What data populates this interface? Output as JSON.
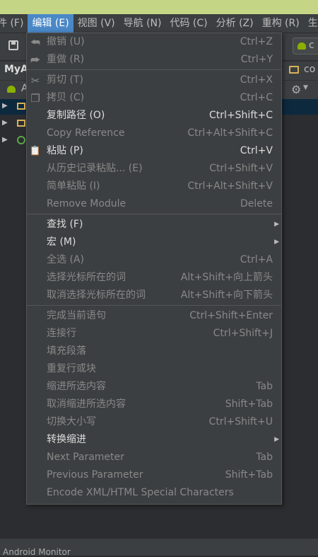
{
  "menubar": [
    {
      "label": "件 (F)"
    },
    {
      "label": "编辑 (E)"
    },
    {
      "label": "视图 (V)"
    },
    {
      "label": "导航 (N)"
    },
    {
      "label": "代码 (C)"
    },
    {
      "label": "分析 (Z)"
    },
    {
      "label": "重构 (R)"
    },
    {
      "label": "生"
    }
  ],
  "toolbar": {
    "right_text": "c"
  },
  "navbar": {
    "project": "MyA",
    "crumb": "co"
  },
  "projbar": {
    "label": "A"
  },
  "statusbar": {
    "label": "Android Monitor"
  },
  "edit_menu": {
    "groups": [
      [
        {
          "label": "撤销 (U)",
          "shortcut": "Ctrl+Z",
          "enabled": false,
          "icon": "undo-icon"
        },
        {
          "label": "重做 (R)",
          "shortcut": "Ctrl+Y",
          "enabled": false,
          "icon": "redo-icon"
        }
      ],
      [
        {
          "label": "剪切 (T)",
          "shortcut": "Ctrl+X",
          "enabled": false,
          "icon": "cut-icon"
        },
        {
          "label": "拷贝 (C)",
          "shortcut": "Ctrl+C",
          "enabled": false,
          "icon": "copy-icon"
        },
        {
          "label": "复制路径 (O)",
          "shortcut": "Ctrl+Shift+C",
          "enabled": true
        },
        {
          "label": "Copy Reference",
          "shortcut": "Ctrl+Alt+Shift+C",
          "enabled": false
        },
        {
          "label": "粘贴 (P)",
          "shortcut": "Ctrl+V",
          "enabled": true,
          "icon": "paste-icon"
        },
        {
          "label": "从历史记录粘贴... (E)",
          "shortcut": "Ctrl+Shift+V",
          "enabled": false
        },
        {
          "label": "简单粘贴 (I)",
          "shortcut": "Ctrl+Alt+Shift+V",
          "enabled": false
        },
        {
          "label": "Remove Module",
          "shortcut": "Delete",
          "enabled": false
        }
      ],
      [
        {
          "label": "查找 (F)",
          "shortcut": "",
          "enabled": true,
          "submenu": true
        },
        {
          "label": "宏 (M)",
          "shortcut": "",
          "enabled": true,
          "submenu": true
        },
        {
          "label": "全选 (A)",
          "shortcut": "Ctrl+A",
          "enabled": false
        },
        {
          "label": "选择光标所在的词",
          "shortcut": "Alt+Shift+向上箭头",
          "enabled": false
        },
        {
          "label": "取消选择光标所在的词",
          "shortcut": "Alt+Shift+向下箭头",
          "enabled": false
        }
      ],
      [
        {
          "label": "完成当前语句",
          "shortcut": "Ctrl+Shift+Enter",
          "enabled": false
        },
        {
          "label": "连接行",
          "shortcut": "Ctrl+Shift+J",
          "enabled": false
        },
        {
          "label": "填充段落",
          "shortcut": "",
          "enabled": false
        },
        {
          "label": "重复行或块",
          "shortcut": "",
          "enabled": false
        },
        {
          "label": "缩进所选内容",
          "shortcut": "Tab",
          "enabled": false
        },
        {
          "label": "取消缩进所选内容",
          "shortcut": "Shift+Tab",
          "enabled": false
        },
        {
          "label": "切换大小写",
          "shortcut": "Ctrl+Shift+U",
          "enabled": false
        },
        {
          "label": "转换缩进",
          "shortcut": "",
          "enabled": true,
          "submenu": true
        },
        {
          "label": "Next Parameter",
          "shortcut": "Tab",
          "enabled": false
        },
        {
          "label": "Previous Parameter",
          "shortcut": "Shift+Tab",
          "enabled": false
        },
        {
          "label": "Encode XML/HTML Special Characters",
          "shortcut": "",
          "enabled": false
        }
      ]
    ]
  }
}
